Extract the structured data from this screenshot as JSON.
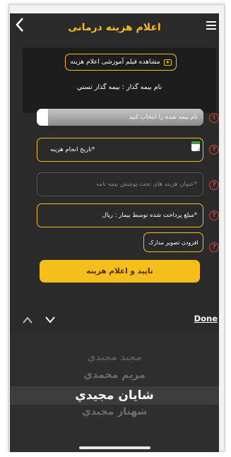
{
  "header": {
    "title": "اعلام هزینه درمانی"
  },
  "info_panel": {
    "tutorial_button_label": "مشاهده فیلم آموزشی اعلام هزینه",
    "policyholder_text": "نام بیمه گذار : بیمه گذار تستي"
  },
  "form": {
    "insured_select_placeholder": "نام بیمه شده را انتخاب کنید",
    "date_field_placeholder": "تاریخ انجام هزینه*",
    "coverage_field_placeholder": "عنوان هزینه های تحت پوشش بیمه نامه*",
    "amount_field_placeholder": "مبلغ پرداخت شده توسط بیمار : ریال*",
    "attach_button_label": "افزودن تصویر مدارک",
    "submit_button_label": "تایید و اعلام هزینه"
  },
  "picker": {
    "done_label": "Done",
    "items": [
      "مجيد مجيدي",
      "مريم محمدي",
      "شايان مجيدي",
      "شهناز مجيدي"
    ],
    "selected_index": 2
  },
  "colors": {
    "accent": "#f5be1a",
    "background": "#2a2a2a",
    "warning": "#d0493a"
  }
}
